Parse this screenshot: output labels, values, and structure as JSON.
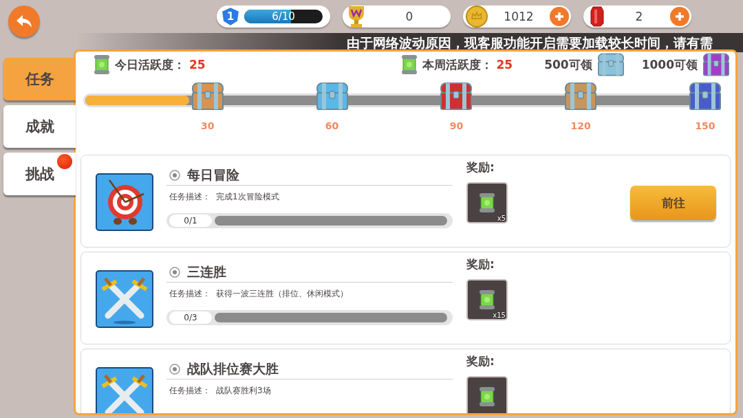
{
  "top_bar": {
    "level": {
      "rank": "1",
      "progress": "6/10",
      "level": 0.6
    },
    "currencies": [
      {
        "kind": "trophy",
        "value": "0",
        "addable": false
      },
      {
        "kind": "coin",
        "value": "1012",
        "addable": true
      },
      {
        "kind": "gem",
        "value": "2",
        "addable": true
      }
    ]
  },
  "notice": "由于网络波动原因，现客服功能开启需要加载较长时间，请有需",
  "side_tabs": [
    {
      "label": "任务",
      "selected": true,
      "dot": false
    },
    {
      "label": "成就",
      "selected": false,
      "dot": false
    },
    {
      "label": "挑战",
      "selected": false,
      "dot": true
    }
  ],
  "activity": {
    "today_label": "今日活跃度：",
    "today_value": "25",
    "week_label": "本周活跃度：",
    "week_value": "25",
    "rewards": [
      {
        "label": "500可领",
        "color": "#8cc3dc"
      },
      {
        "label": "1000可领",
        "color": "#a53cc8"
      }
    ],
    "level": 0.167,
    "milestones": [
      {
        "label": "30",
        "color": "#d9924f"
      },
      {
        "label": "60",
        "color": "#5ab8e8"
      },
      {
        "label": "90",
        "color": "#d03030"
      },
      {
        "label": "120",
        "color": "#c8955a"
      },
      {
        "label": "150",
        "color": "#4a5ccc"
      }
    ]
  },
  "tasks": [
    {
      "kind": "target",
      "title": "每日冒险",
      "desc_label": "任务描述：",
      "desc": "完成1次冒险模式",
      "progress": "0/1",
      "level": 0,
      "reward_label": "奖励:",
      "reward_count": "x5",
      "button": "前往"
    },
    {
      "kind": "swords",
      "title": "三连胜",
      "desc_label": "任务描述：",
      "desc": "获得一波三连胜（排位、休闲模式）",
      "progress": "0/3",
      "level": 0,
      "reward_label": "奖励:",
      "reward_count": "x15"
    },
    {
      "kind": "swords",
      "title": "战队排位赛大胜",
      "desc_label": "任务描述：",
      "desc": "战队赛胜利3场",
      "reward_label": "奖励:"
    }
  ]
}
